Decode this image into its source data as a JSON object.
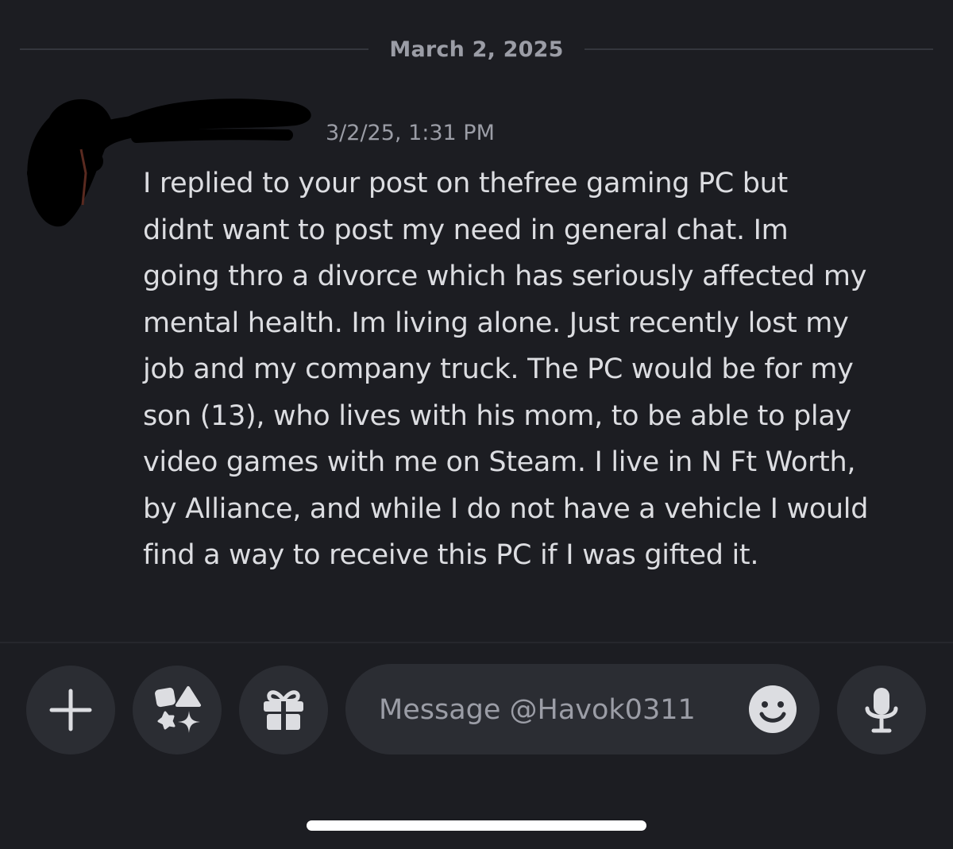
{
  "chat": {
    "date_divider": "March 2, 2025",
    "message": {
      "timestamp": "3/2/25, 1:31 PM",
      "text": "I replied to your post on thefree gaming PC but\ndidnt want to post my need in general chat.  Im\ngoing thro a divorce which has seriously affected my\nmental health.  Im living alone.  Just recently lost my\njob and my company truck.  The PC would be for my\nson (13), who lives with his mom, to be able to play\nvideo games with me on Steam. I live in N Ft Worth,\nby Alliance, and while I do not have a vehicle I would\nfind a way to receive this PC if I was gifted it."
    }
  },
  "composer": {
    "placeholder": "Message @Havok0311",
    "buttons": [
      "plus-icon",
      "apps-icon",
      "gift-icon",
      "emoji-icon",
      "microphone-icon"
    ]
  },
  "colors": {
    "background": "#1c1d22",
    "button_bg": "#2b2d33",
    "text": "#dcdde1",
    "muted": "#9b9da6"
  }
}
